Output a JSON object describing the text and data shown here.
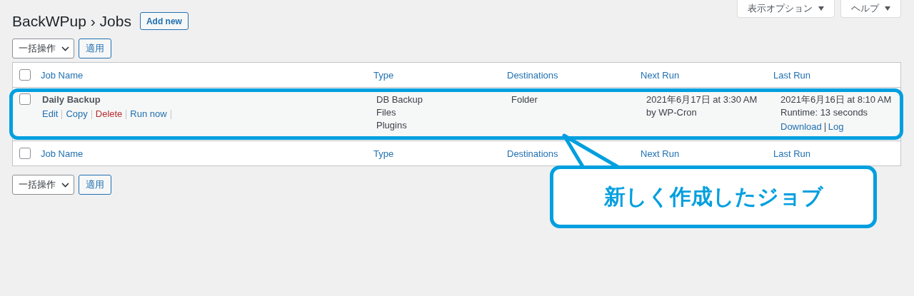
{
  "screen_tabs": [
    {
      "label": "表示オプション"
    },
    {
      "label": "ヘルプ"
    }
  ],
  "header": {
    "title": "BackWPup › Jobs",
    "add_button": "Add new"
  },
  "bulk_actions_top": {
    "select": "一括操作",
    "apply": "適用"
  },
  "table": {
    "columns": [
      {
        "label": "Job Name",
        "checked": false
      },
      {
        "label": "Type"
      },
      {
        "label": "Destinations"
      },
      {
        "label": "Next Run"
      },
      {
        "label": "Last Run"
      }
    ],
    "rows": [
      {
        "checked": false,
        "name": "Daily Backup",
        "actions": [
          {
            "label": "Edit",
            "kind": "link"
          },
          {
            "label": "Copy",
            "kind": "link"
          },
          {
            "label": "Delete",
            "kind": "delete"
          },
          {
            "label": "Run now",
            "kind": "link"
          }
        ],
        "type": [
          "DB Backup",
          "Files",
          "Plugins"
        ],
        "destinations": "Folder",
        "next_run": "2021年6月17日 at 3:30 AM by WP-Cron",
        "last_run": [
          "2021年6月16日 at 8:10 AM",
          "Runtime: 13 seconds"
        ],
        "last_run_links": [
          "Download",
          "Log"
        ],
        "highlighted": true
      }
    ],
    "footer_columns": [
      {
        "label": "Job Name",
        "checked": false
      },
      {
        "label": "Type"
      },
      {
        "label": "Destinations"
      },
      {
        "label": "Next Run"
      },
      {
        "label": "Last Run"
      }
    ]
  },
  "bulk_actions_bottom": {
    "select": "一括操作",
    "apply": "適用"
  },
  "callout": {
    "text": "新しく作成したジョブ"
  }
}
